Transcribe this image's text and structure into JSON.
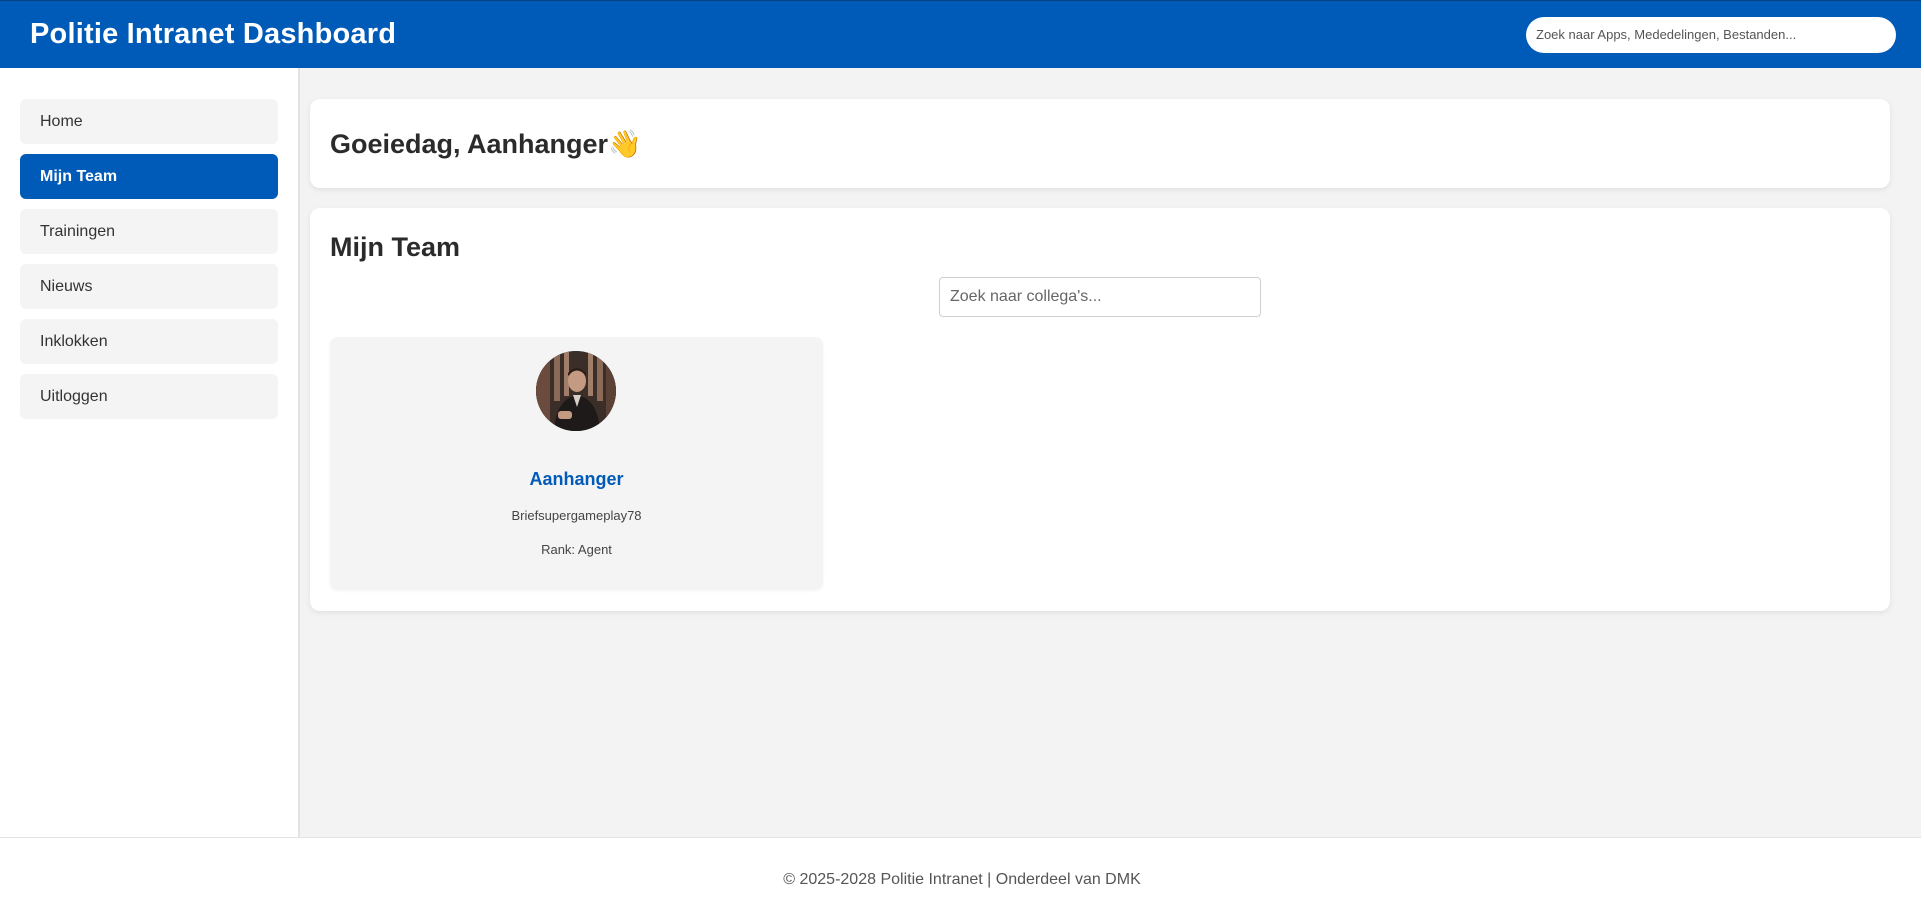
{
  "header": {
    "title": "Politie Intranet Dashboard",
    "search_placeholder": "Zoek naar Apps, Mededelingen, Bestanden..."
  },
  "sidebar": {
    "items": [
      {
        "label": "Home",
        "active": false
      },
      {
        "label": "Mijn Team",
        "active": true
      },
      {
        "label": "Trainingen",
        "active": false
      },
      {
        "label": "Nieuws",
        "active": false
      },
      {
        "label": "Inklokken",
        "active": false
      },
      {
        "label": "Uitloggen",
        "active": false
      }
    ]
  },
  "main": {
    "greeting": "Goeiedag, Aanhanger👋",
    "team": {
      "title": "Mijn Team",
      "search_placeholder": "Zoek naar collega's...",
      "members": [
        {
          "name": "Aanhanger",
          "username": "Briefsupergameplay78",
          "rank": "Rank: Agent"
        }
      ]
    }
  },
  "footer": {
    "text": "© 2025-2028 Politie Intranet | Onderdeel van DMK"
  },
  "colors": {
    "brand": "#005bb8",
    "background": "#f3f3f3",
    "card": "#ffffff"
  }
}
